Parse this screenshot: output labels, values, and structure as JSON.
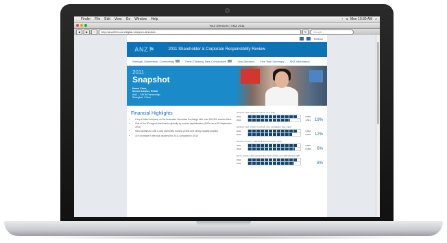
{
  "menubar": {
    "items": [
      "Finder",
      "File",
      "Edit",
      "View",
      "Go",
      "Window",
      "Help"
    ],
    "clock": "Mon 10:30 AM"
  },
  "browser": {
    "window_title": "Your Directors | ANZ 2011",
    "url": "http://anz2011.com/digital-eris/your-directors",
    "search_placeholder": "Google"
  },
  "site": {
    "util_link": "Toolbox",
    "logo": "ANZ",
    "header_title": "2011 Shareholder & Corporate Responsibility Review",
    "nav": [
      "Strength, Momentum, Connectivity",
      "Fresh Thinking, New Connections",
      "Your Directors",
      "Five Year Summary",
      "ANZ Information"
    ],
    "hero": {
      "year": "2011",
      "title": "Snapshot",
      "caption": [
        "Karen Chen,",
        "Senior Adviser, Retail",
        "ANZ – SRCB Partnership",
        "Shanghai, China"
      ]
    },
    "financial": {
      "title": "Financial Highlights",
      "bullets": [
        "A top 4 listed company on the Australian Securities Exchange with over 490,000 shareholders",
        "One of the 50 largest listed banks globally by market capitalisation (AUDs as at 30 September 2011)",
        "Well capitalised, with a well diversified funding profile and strong liquidity position",
        "11% increase in the total dividend for 2011 compared to 2010"
      ]
    },
    "metrics": [
      {
        "label": "GROUP NET PROFIT AFTER TAX ($M)",
        "rows": [
          {
            "year": "2011",
            "value": "5,355",
            "fill": 0.95
          },
          {
            "year": "2010",
            "value": "4,501",
            "fill": 0.8
          }
        ],
        "pct": "19%"
      },
      {
        "label": "GROUP NET PROFIT AFTER TAX (UNDERLYING) ($M)",
        "rows": [
          {
            "year": "2011",
            "value": "5,652",
            "fill": 0.95
          },
          {
            "year": "2010",
            "value": "5,025",
            "fill": 0.84
          }
        ],
        "pct": "12%"
      },
      {
        "label": "GROUP PROFIT BEFORE PROVISIONS ($M)",
        "rows": [
          {
            "year": "2011",
            "value": "8,999",
            "fill": 0.95
          },
          {
            "year": "2010",
            "value": "8,488",
            "fill": 0.9
          }
        ],
        "pct": "6%"
      },
      {
        "label": "NET LOANS AND ADVANCES INCLUDING ACCEPTANCES ($B)",
        "rows": [
          {
            "year": "2011",
            "value": "",
            "fill": 0.95
          },
          {
            "year": "2010",
            "value": "",
            "fill": 0.88
          }
        ],
        "pct": "8%"
      }
    ]
  }
}
